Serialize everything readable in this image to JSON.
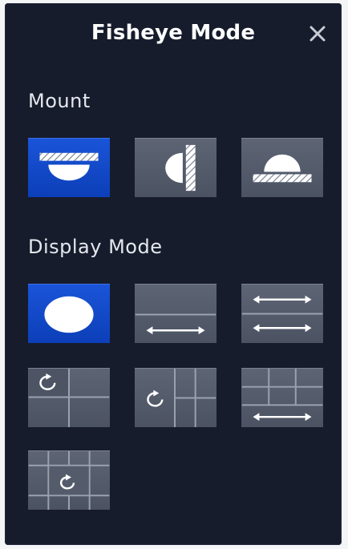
{
  "dialog": {
    "title": "Fisheye Mode",
    "close_label": "×"
  },
  "mount": {
    "label": "Mount",
    "options": [
      {
        "icon": "ceiling-mount-icon",
        "selected": true
      },
      {
        "icon": "wall-mount-icon",
        "selected": false
      },
      {
        "icon": "desktop-mount-icon",
        "selected": false
      }
    ]
  },
  "display_mode": {
    "label": "Display Mode",
    "options": [
      {
        "icon": "fisheye-original-icon",
        "selected": true
      },
      {
        "icon": "fisheye-panorama-icon",
        "selected": false
      },
      {
        "icon": "double-panorama-icon",
        "selected": false
      },
      {
        "icon": "fisheye-3ptz-icon",
        "selected": false
      },
      {
        "icon": "fisheye-ptz-strip-icon",
        "selected": false
      },
      {
        "icon": "panorama-3ptz-icon",
        "selected": false
      },
      {
        "icon": "fisheye-8ptz-icon",
        "selected": false
      }
    ]
  },
  "colors": {
    "panel_bg": "#161c2c",
    "selected_bg": "#1a54d8",
    "button_bg": "#565d6d",
    "text": "#ffffff"
  }
}
